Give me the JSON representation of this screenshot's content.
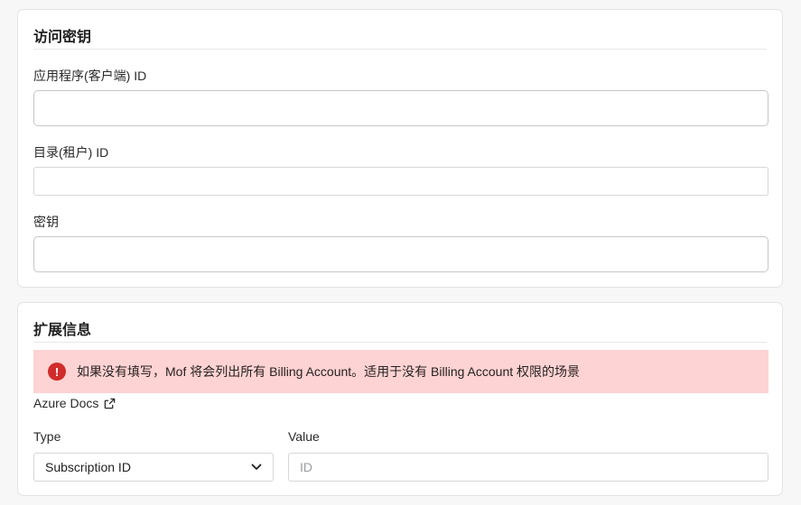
{
  "access_key_section": {
    "title": "访问密钥",
    "app_id": {
      "label": "应用程序(客户端) ID",
      "value": ""
    },
    "tenant_id": {
      "label": "目录(租户) ID",
      "value": ""
    },
    "secret": {
      "label": "密钥",
      "value": ""
    }
  },
  "extended_info_section": {
    "title": "扩展信息",
    "alert": {
      "icon": "!",
      "text": "如果没有填写，Mof 将会列出所有 Billing Account。适用于没有 Billing Account 权限的场景",
      "background": "#fdd3d3",
      "icon_color": "#d12c2c"
    },
    "docs_link": {
      "label": "Azure Docs",
      "icon": "external-link-icon"
    },
    "type_field": {
      "label": "Type",
      "selected": "Subscription ID"
    },
    "value_field": {
      "label": "Value",
      "placeholder": "ID",
      "value": ""
    }
  }
}
